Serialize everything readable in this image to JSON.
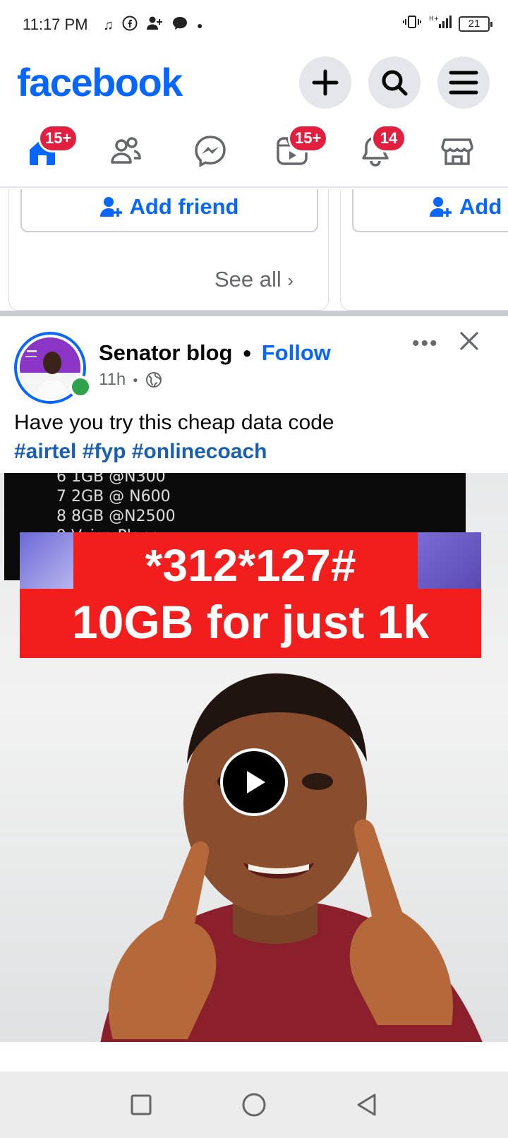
{
  "status_bar": {
    "time": "11:17 PM",
    "battery": "21"
  },
  "header": {
    "logo": "facebook",
    "actions": [
      "plus-icon",
      "search-icon",
      "menu-icon"
    ]
  },
  "nav": {
    "home_badge": "15+",
    "video_badge": "15+",
    "notifications_badge": "14"
  },
  "suggestions": {
    "add_friend_label": "Add friend",
    "add_label_partial": "Add",
    "see_all": "See all"
  },
  "post": {
    "author": "Senator blog",
    "follow": "Follow",
    "time": "11h",
    "text": "Have you try this cheap data code",
    "hashtags": "#airtel #fyp #onlinecoach",
    "video": {
      "screen_lines": [
        "6 1GB @N300",
        "7 2GB @ N600",
        "8 8GB @N2500",
        "9 Voice Plans"
      ],
      "code": "*312*127#",
      "offer": "10GB for just 1k"
    }
  },
  "colors": {
    "brand": "#0866ff",
    "badge": "#e41e3f",
    "online": "#31a24c",
    "banner": "#f21d1d"
  }
}
